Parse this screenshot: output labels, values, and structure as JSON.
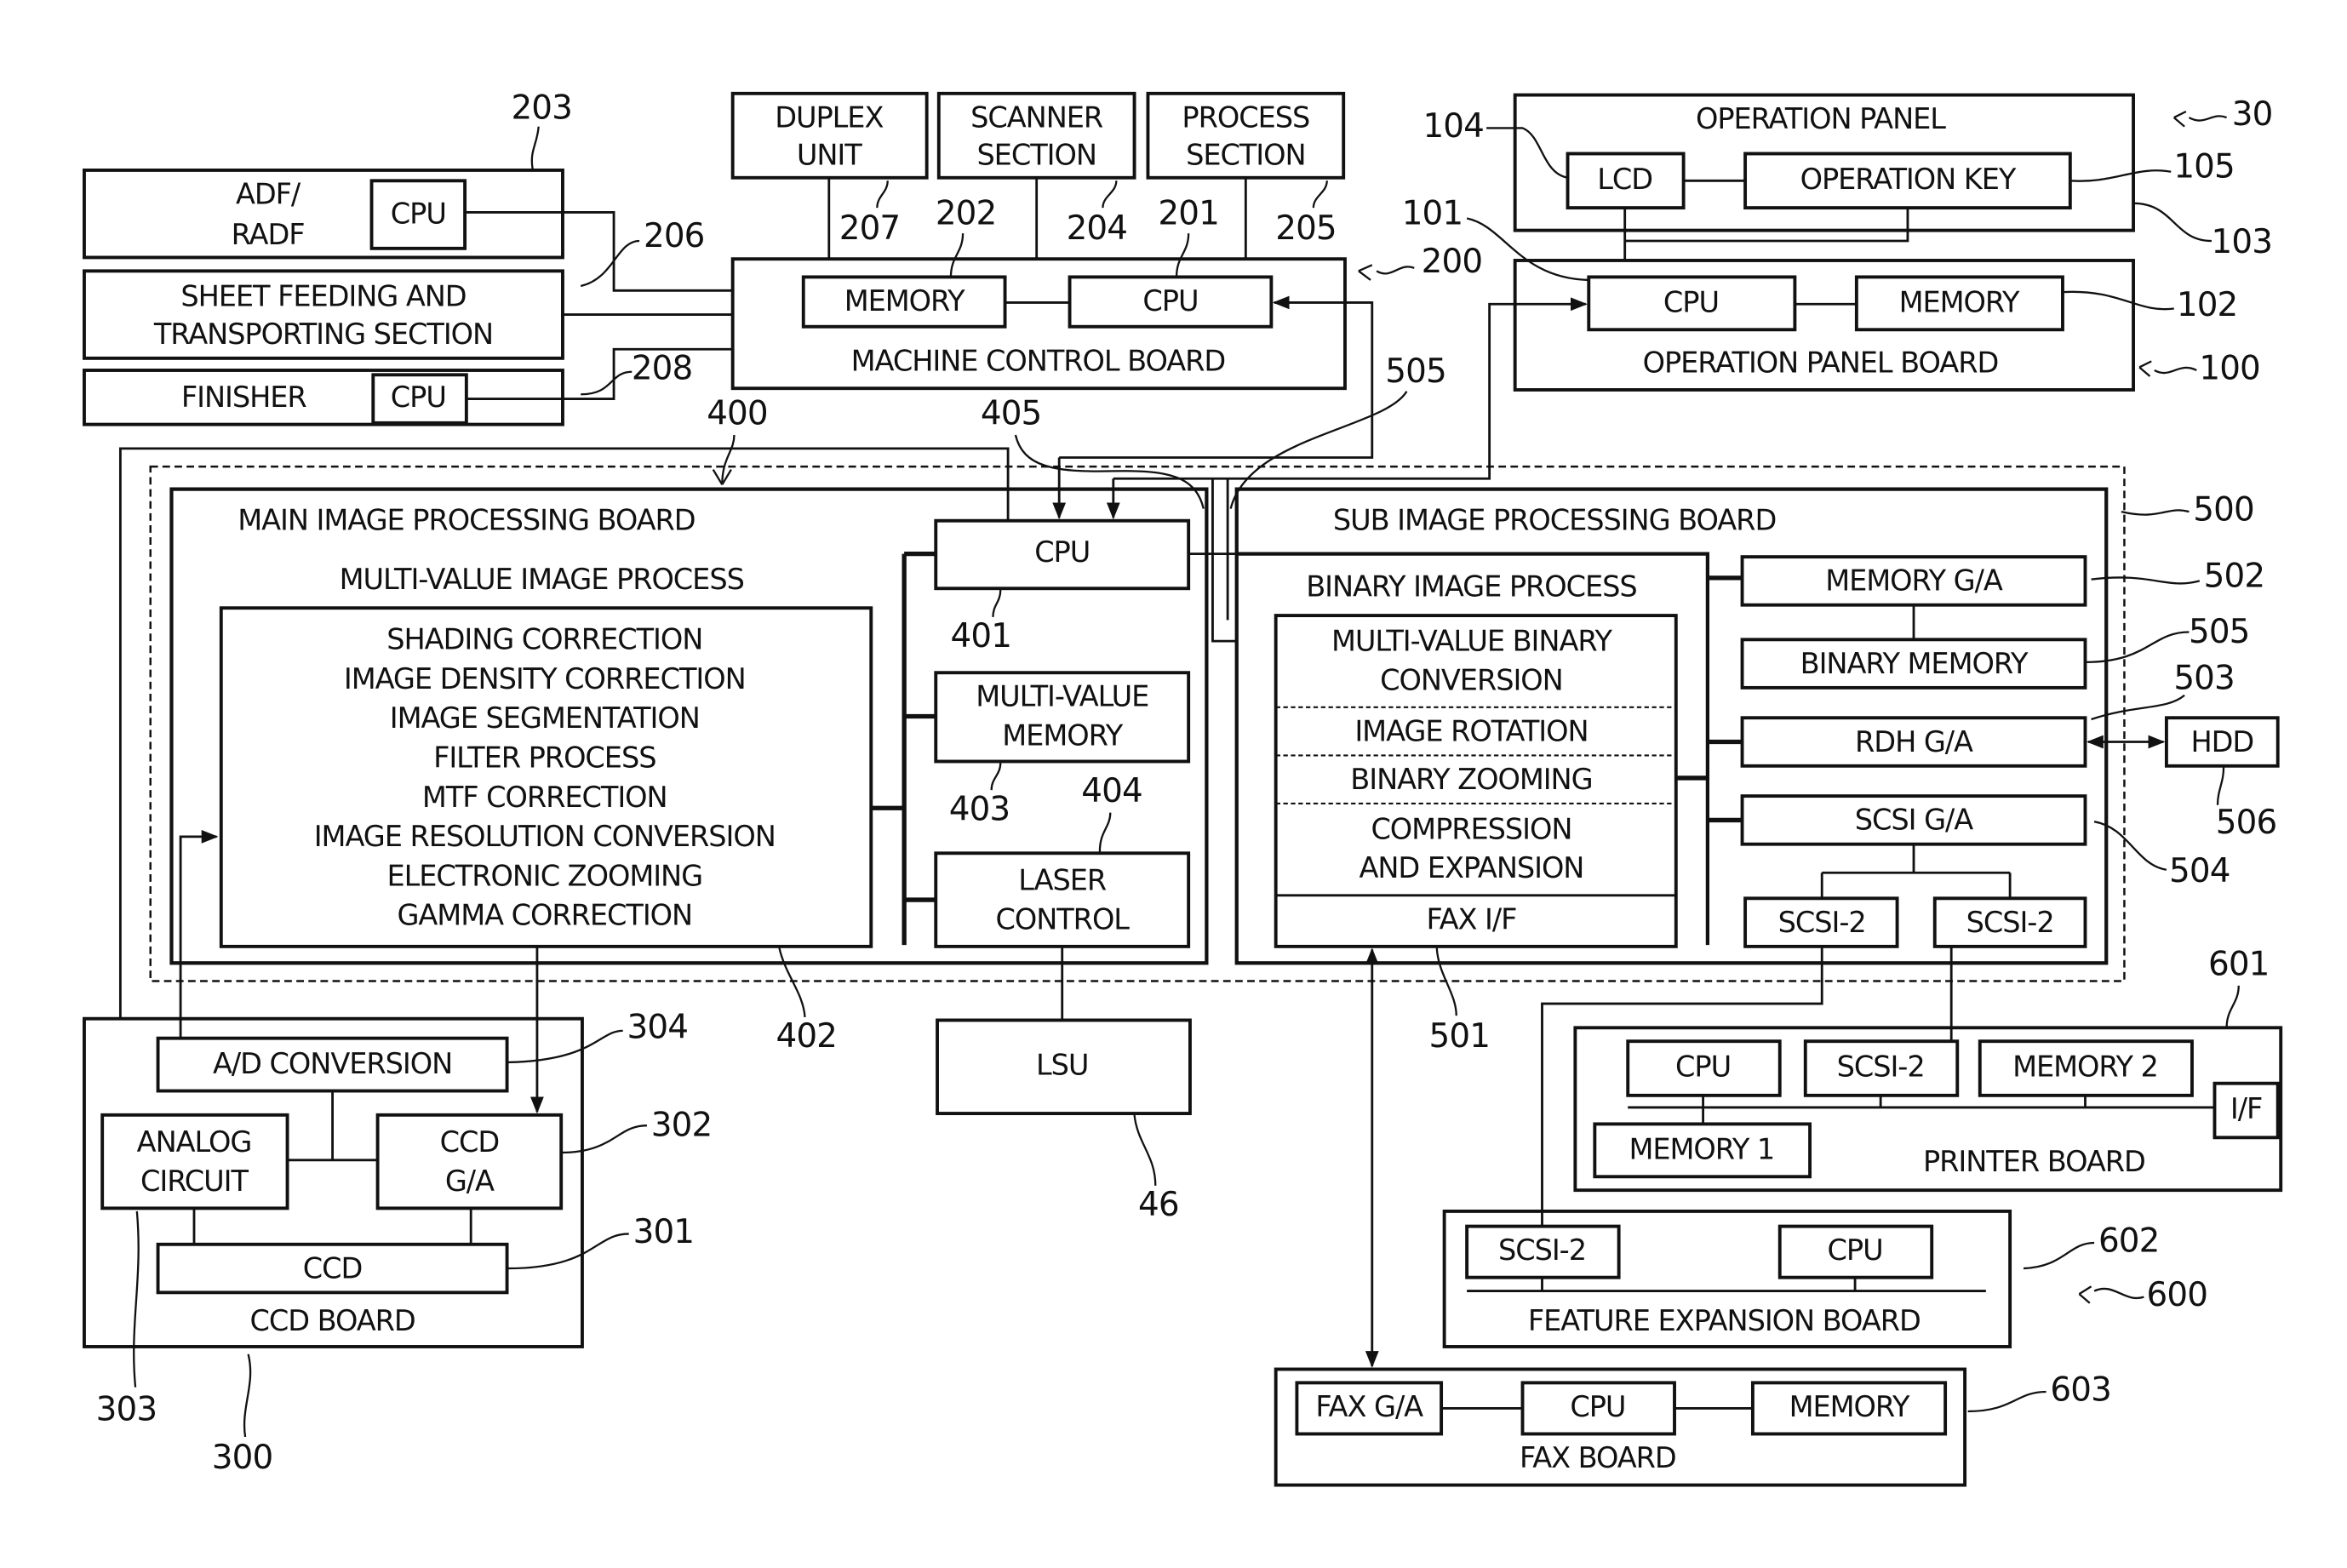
{
  "figure": {
    "boards": {
      "adf": {
        "label_lines": [
          "ADF/",
          "RADF"
        ],
        "cpu": "CPU",
        "ref": "203"
      },
      "sheet_feeding": {
        "label_lines": [
          "SHEET FEEDING AND",
          "TRANSPORTING SECTION"
        ],
        "ref": "206"
      },
      "finisher": {
        "label": "FINISHER",
        "cpu": "CPU",
        "ref": "208"
      },
      "duplex": {
        "label_lines": [
          "DUPLEX",
          "UNIT"
        ],
        "ref": "207"
      },
      "scanner": {
        "label_lines": [
          "SCANNER",
          "SECTION"
        ],
        "ref": "204"
      },
      "process": {
        "label_lines": [
          "PROCESS",
          "SECTION"
        ],
        "ref": "205"
      },
      "machine_control": {
        "label": "MACHINE CONTROL BOARD",
        "memory": "MEMORY",
        "memory_ref": "202",
        "cpu": "CPU",
        "cpu_ref": "201",
        "ref": "200"
      },
      "operation_panel": {
        "label": "OPERATION PANEL",
        "lcd": "LCD",
        "lcd_ref": "104",
        "key": "OPERATION KEY",
        "key_ref": "105",
        "ref": "103",
        "group_ref": "30"
      },
      "operation_panel_board": {
        "label": "OPERATION PANEL BOARD",
        "cpu": "CPU",
        "cpu_ref": "101",
        "memory": "MEMORY",
        "memory_ref": "102",
        "ref": "100"
      },
      "main_image": {
        "label": "MAIN IMAGE PROCESSING BOARD",
        "ref": "400",
        "process_title": "MULTI-VALUE IMAGE PROCESS",
        "process_ref": "402",
        "process_items": [
          "SHADING CORRECTION",
          "IMAGE DENSITY CORRECTION",
          "IMAGE SEGMENTATION",
          "FILTER PROCESS",
          "MTF CORRECTION",
          "IMAGE RESOLUTION CONVERSION",
          "ELECTRONIC ZOOMING",
          "GAMMA  CORRECTION"
        ],
        "cpu": "CPU",
        "cpu_ref": "401",
        "mv_memory_lines": [
          "MULTI-VALUE",
          "MEMORY"
        ],
        "mv_memory_ref": "403",
        "laser_lines": [
          "LASER",
          "CONTROL"
        ],
        "laser_ref": "404",
        "bus_ref": "405"
      },
      "sub_image": {
        "label": "SUB IMAGE PROCESSING BOARD",
        "ref": "500",
        "process_title": "BINARY IMAGE PROCESS",
        "process_ref": "501",
        "process_sections": [
          [
            "MULTI-VALUE BINARY",
            "CONVERSION"
          ],
          [
            "IMAGE ROTATION"
          ],
          [
            "BINARY ZOOMING"
          ],
          [
            "COMPRESSION",
            "AND EXPANSION"
          ]
        ],
        "fax_if": "FAX  I/F",
        "memory_ga": "MEMORY G/A",
        "memory_ga_ref": "502",
        "binary_memory": "BINARY MEMORY",
        "binary_memory_ref": "505",
        "rdh_ga": "RDH G/A",
        "rdh_ga_ref": "503",
        "scsi_ga": "SCSI G/A",
        "scsi_ga_ref": "504",
        "scsi2_a": "SCSI-2",
        "scsi2_b": "SCSI-2",
        "link_ref": "505"
      },
      "hdd": {
        "label": "HDD",
        "ref": "506"
      },
      "lsu": {
        "label": "LSU",
        "ref": "46"
      },
      "ccd": {
        "label": "CCD BOARD",
        "ref": "300",
        "ad": "A/D CONVERSION",
        "ad_ref": "304",
        "analog_lines": [
          "ANALOG",
          "CIRCUIT"
        ],
        "analog_ref": "303",
        "ccd_ga_lines": [
          "CCD",
          "G/A"
        ],
        "ccd_ga_ref": "302",
        "ccd": "CCD",
        "ccd_ref": "301"
      },
      "printer": {
        "label": "PRINTER BOARD",
        "ref": "601",
        "cpu": "CPU",
        "scsi2": "SCSI-2",
        "memory2": "MEMORY 2",
        "memory1": "MEMORY 1",
        "if": "I/F"
      },
      "feature": {
        "label": "FEATURE EXPANSION BOARD",
        "ref": "602",
        "scsi2": "SCSI-2",
        "cpu": "CPU",
        "group_ref": "600"
      },
      "fax": {
        "label": "FAX BOARD",
        "ref": "603",
        "fax_ga": "FAX G/A",
        "cpu": "CPU",
        "memory": "MEMORY"
      }
    }
  }
}
